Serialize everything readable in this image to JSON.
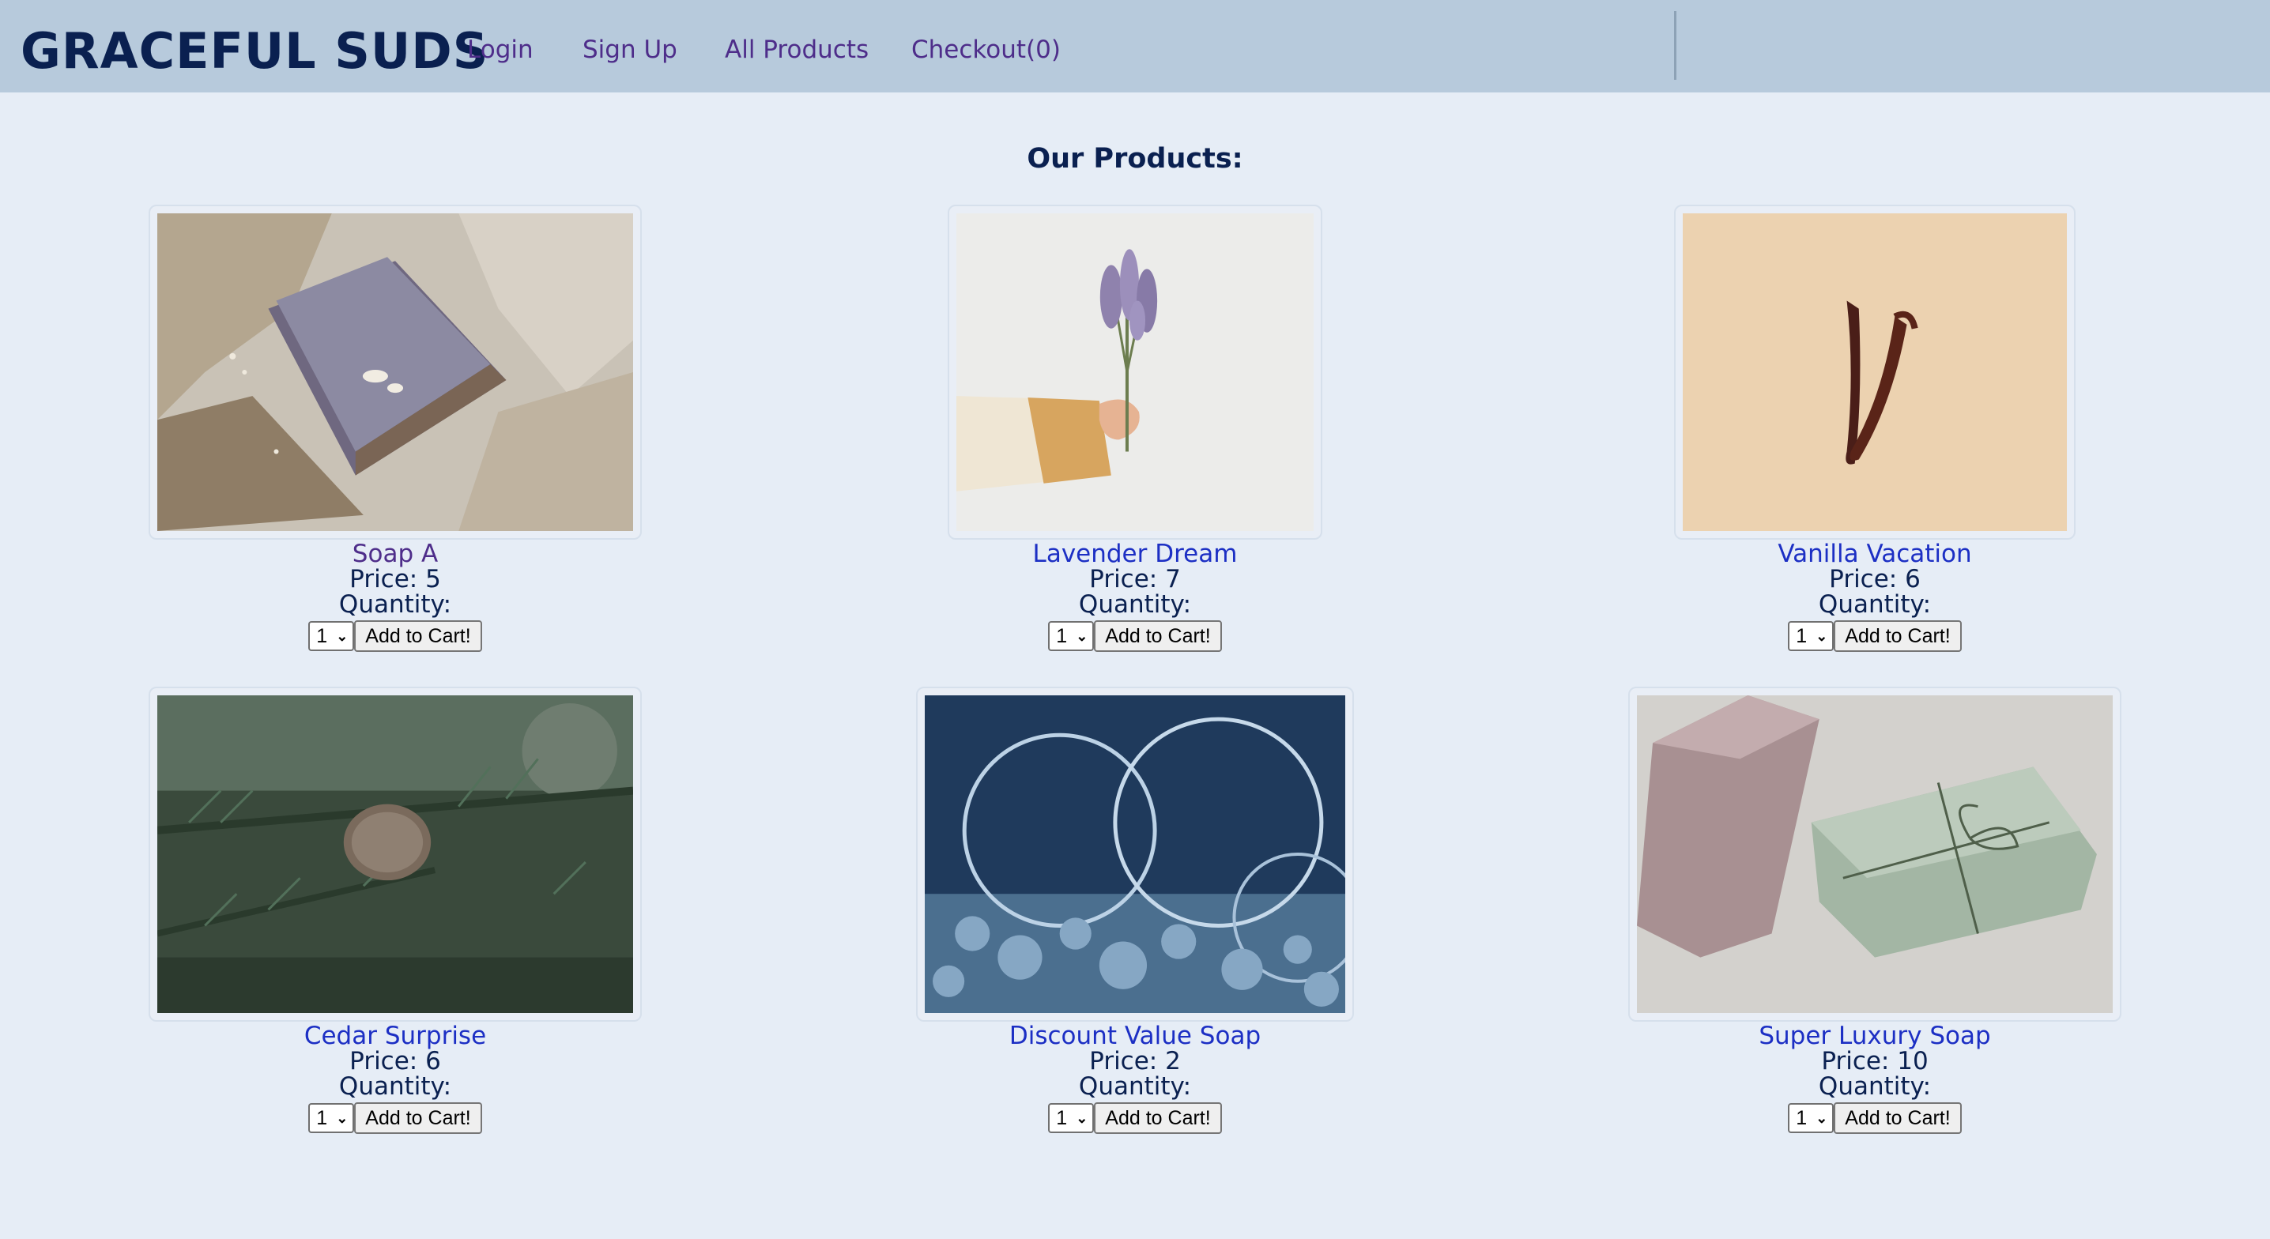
{
  "nav": {
    "brand": "GRACEFUL SUDS",
    "login": "Login",
    "signup": "Sign Up",
    "all_products": "All Products",
    "checkout": "Checkout(0)"
  },
  "main": {
    "title": "Our Products:",
    "price_prefix": "Price: ",
    "quantity_label": "Quantity:",
    "button_label": "Add to Cart!",
    "selected_quantity": "1"
  },
  "products": [
    {
      "name": "Soap A",
      "price": "Price: 5",
      "quantity_label": "Quantity:",
      "qty": "1",
      "button": "Add to Cart!",
      "image": "grey-soap-bar-on-paper",
      "visited": true
    },
    {
      "name": "Lavender Dream",
      "price": "Price: 7",
      "quantity_label": "Quantity:",
      "qty": "1",
      "button": "Add to Cart!",
      "image": "hand-holding-lavender"
    },
    {
      "name": "Vanilla Vacation",
      "price": "Price: 6",
      "quantity_label": "Quantity:",
      "qty": "1",
      "button": "Add to Cart!",
      "image": "vanilla-beans"
    },
    {
      "name": "Cedar Surprise",
      "price": "Price: 6",
      "quantity_label": "Quantity:",
      "qty": "1",
      "button": "Add to Cart!",
      "image": "cedar-cone-branch"
    },
    {
      "name": "Discount Value Soap",
      "price": "Price: 2",
      "quantity_label": "Quantity:",
      "qty": "1",
      "button": "Add to Cart!",
      "image": "soap-bubbles"
    },
    {
      "name": "Super Luxury Soap",
      "price": "Price: 10",
      "quantity_label": "Quantity:",
      "qty": "1",
      "button": "Add to Cart!",
      "image": "two-soap-bars-with-twine"
    }
  ],
  "colors": {
    "navbar_bg": "#b7cadc",
    "page_bg": "#e6edf6",
    "brand": "#0a2050",
    "nav_link": "#4e2d8a",
    "product_link": "#1c2fc4"
  }
}
